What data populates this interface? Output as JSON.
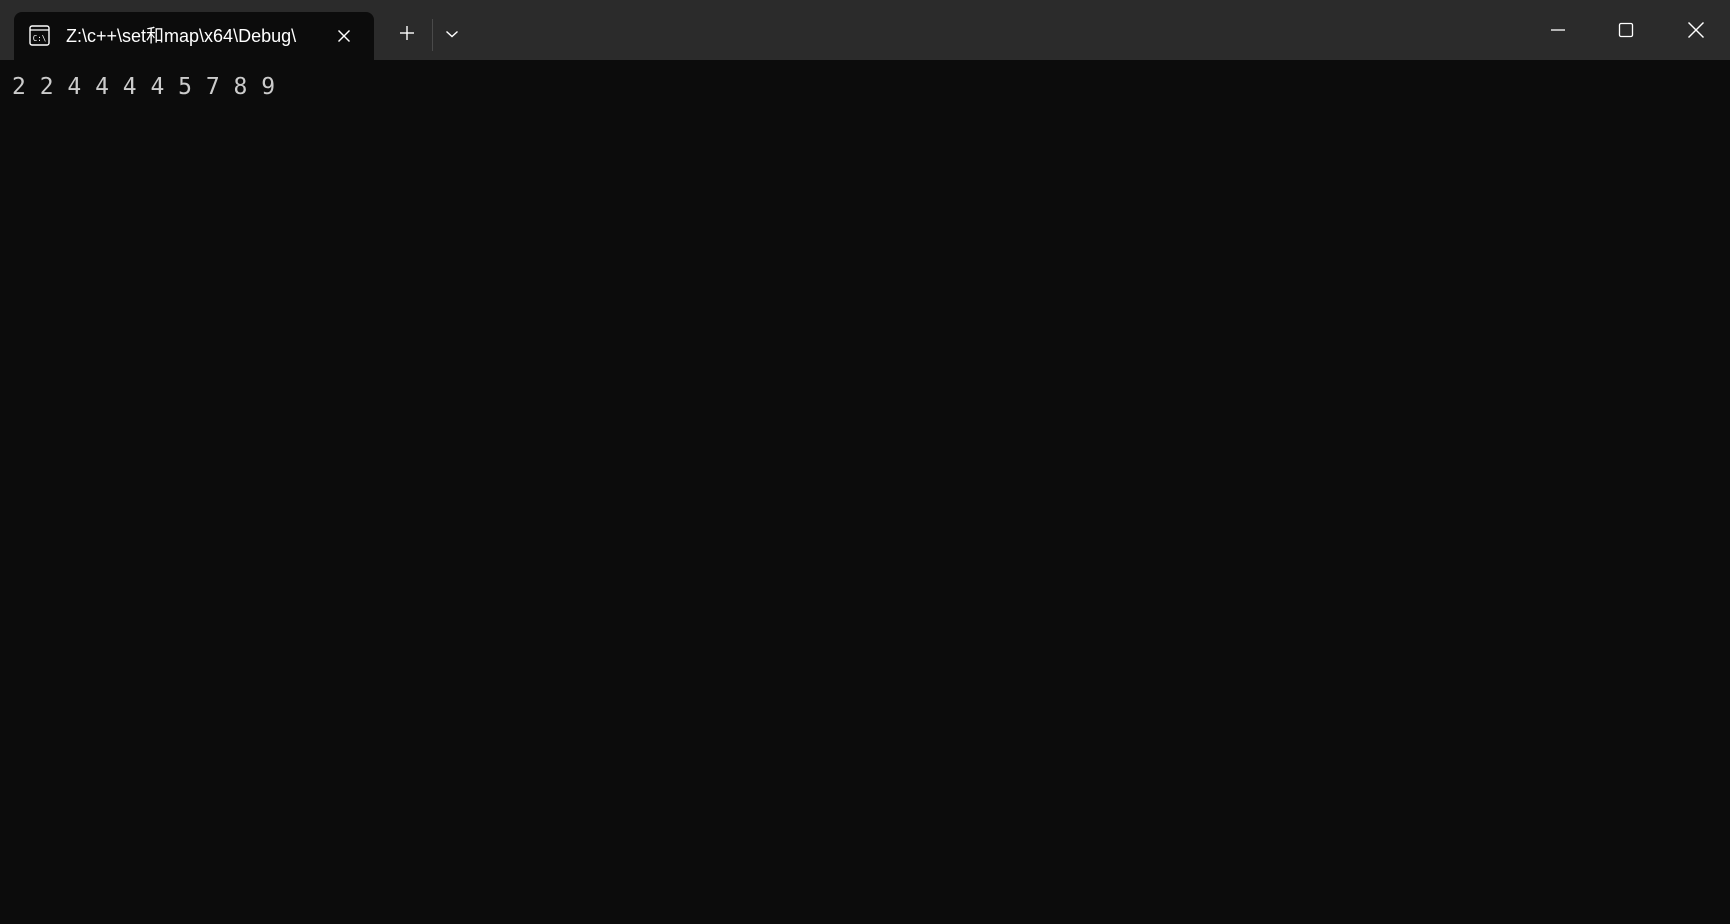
{
  "window": {
    "tab_title": "Z:\\c++\\set和map\\x64\\Debug\\",
    "tab_icon": "cmd-icon"
  },
  "titlebar": {
    "new_tab_icon": "plus-icon",
    "dropdown_icon": "chevron-down-icon",
    "minimize_icon": "minimize-icon",
    "maximize_icon": "maximize-icon",
    "close_icon": "close-icon"
  },
  "terminal": {
    "output": "2 2 4 4 4 4 5 7 8 9",
    "background": "#0c0c0c",
    "foreground": "#cccccc"
  }
}
